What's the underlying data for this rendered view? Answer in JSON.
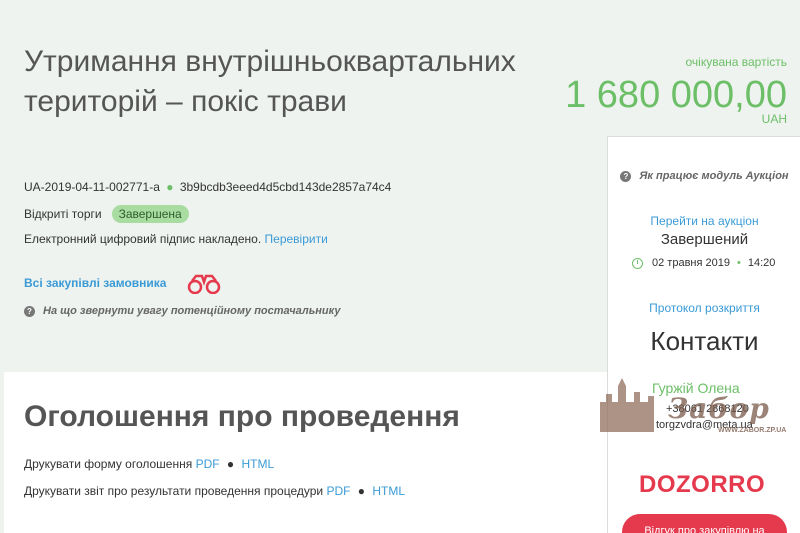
{
  "tender": {
    "title": "Утримання внутрішньоквартальних територій – покіс трави",
    "id": "UA-2019-04-11-002771-a",
    "hash": "3b9bcdb3eeed4d5cbd143de2857a74c4",
    "procedure_type": "Відкриті торги",
    "status": "Завершена",
    "signature_text": "Електронний цифровий підпис накладено.",
    "signature_link": "Перевірити",
    "all_purchases_link": "Всі закупівлі замовника",
    "attention_text": "На що звернути увагу потенційному постачальнику"
  },
  "price": {
    "label": "очікувана вартість",
    "value": "1 680 000,00",
    "currency": "UAH"
  },
  "auction": {
    "how_it_works": "Як працює модуль Аукціон",
    "goto_link": "Перейти на аукціон",
    "status": "Завершений",
    "date": "02 травня 2019",
    "time": "14:20",
    "protocol_link": "Протокол розкриття"
  },
  "contacts": {
    "title": "Контакти",
    "name": "Гуржій Олена",
    "phone": "+38061 2868120",
    "email": "torgzvdra@meta.ua"
  },
  "dozorro": {
    "logo": "DOZORRO",
    "review_button": "Відгук про закупівлю на"
  },
  "announcement": {
    "title": "Оголошення про проведення",
    "print_form_label": "Друкувати форму оголошення",
    "print_report_label": "Друкувати звіт про результати проведення процедури",
    "pdf": "PDF",
    "html": "HTML",
    "separator": "●"
  },
  "watermark": {
    "brand": "Забор",
    "site": "WWW.ZABOR.ZP.UA"
  },
  "colors": {
    "accent_green": "#6cbf67",
    "link_blue": "#3a9ad6",
    "dozorro_red": "#e53a4e",
    "top_band": "#eef3ef"
  }
}
